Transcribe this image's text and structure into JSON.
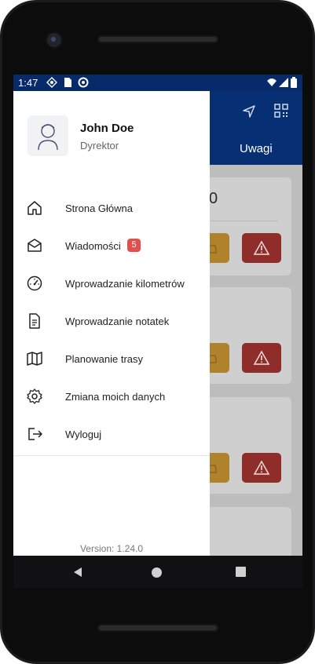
{
  "status": {
    "time": "1:47",
    "icons": [
      "location-icon",
      "sim-icon",
      "sync-icon",
      "wifi-icon",
      "signal-icon",
      "battery-icon"
    ]
  },
  "appbar": {
    "tab_label": "Uwagi",
    "icons": [
      "navigation-icon",
      "qr-code-icon"
    ]
  },
  "cards": [
    {
      "value": "0"
    },
    {
      "value": ""
    },
    {
      "value": ""
    },
    {
      "value": ""
    }
  ],
  "drawer": {
    "user": {
      "name": "John Doe",
      "role": "Dyrektor"
    },
    "menu": [
      {
        "label": "Strona Główna",
        "icon": "home-icon"
      },
      {
        "label": "Wiadomości",
        "icon": "mail-icon",
        "badge": "5"
      },
      {
        "label": "Wprowadzanie kilometrów",
        "icon": "speedometer-icon"
      },
      {
        "label": "Wprowadzanie notatek",
        "icon": "document-icon"
      },
      {
        "label": "Planowanie trasy",
        "icon": "map-icon"
      },
      {
        "label": "Zmiana moich danych",
        "icon": "settings-icon"
      },
      {
        "label": "Wyloguj",
        "icon": "logout-icon"
      }
    ],
    "version": "Version: 1.24.0"
  },
  "colors": {
    "primary": "#072F74",
    "badge": "#E0504E",
    "warning_button": "#B0822C",
    "danger_button": "#8E2D2A"
  }
}
